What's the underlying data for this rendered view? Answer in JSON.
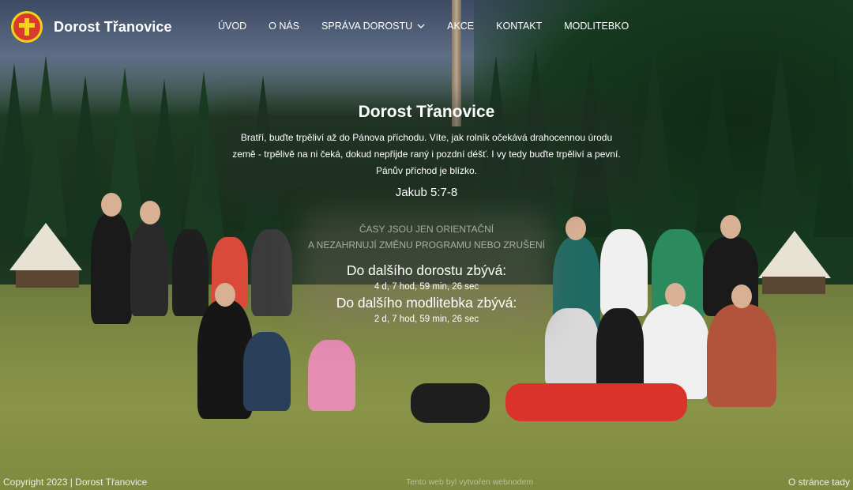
{
  "header": {
    "brand": "Dorost Třanovice",
    "logo_icon": "cross-emblem-icon",
    "nav": [
      {
        "label": "ÚVOD"
      },
      {
        "label": "O NÁS"
      },
      {
        "label": "SPRÁVA DOROSTU",
        "has_dropdown": true
      },
      {
        "label": "AKCE"
      },
      {
        "label": "KONTAKT"
      },
      {
        "label": "MODLITEBKO"
      }
    ]
  },
  "hero": {
    "title": "Dorost Třanovice",
    "verse": "Bratří, buďte trpěliví až do Pánova příchodu. Víte, jak rolník očekává drahocennou úrodu země - trpělivě na ni čeká, dokud nepřijde raný i pozdní déšť. I vy tedy buďte trpěliví a pevní. Pánův příchod je blízko.",
    "reference": "Jakub 5:7-8"
  },
  "notice": {
    "line1": "ČASY JSOU JEN ORIENTAČNÍ",
    "line2": "A NEZAHRNUJÍ ZMĚNU PROGRAMU NEBO ZRUŠENÍ"
  },
  "countdowns": [
    {
      "title": "Do dalšího dorostu zbývá:",
      "value": "4 d, 7 hod, 59 min, 26 sec"
    },
    {
      "title": "Do dalšího modlitebka zbývá:",
      "value": "2 d, 7 hod, 59 min, 26 sec"
    }
  ],
  "footer": {
    "copyright": "Copyright 2023 | Dorost Třanovice",
    "center": "Tento web byl vytvořen webnodem",
    "about": "O stránce tady"
  },
  "colors": {
    "logo_ring": "#f4d21a",
    "logo_fill": "#d83a2c",
    "text": "#ffffff"
  }
}
